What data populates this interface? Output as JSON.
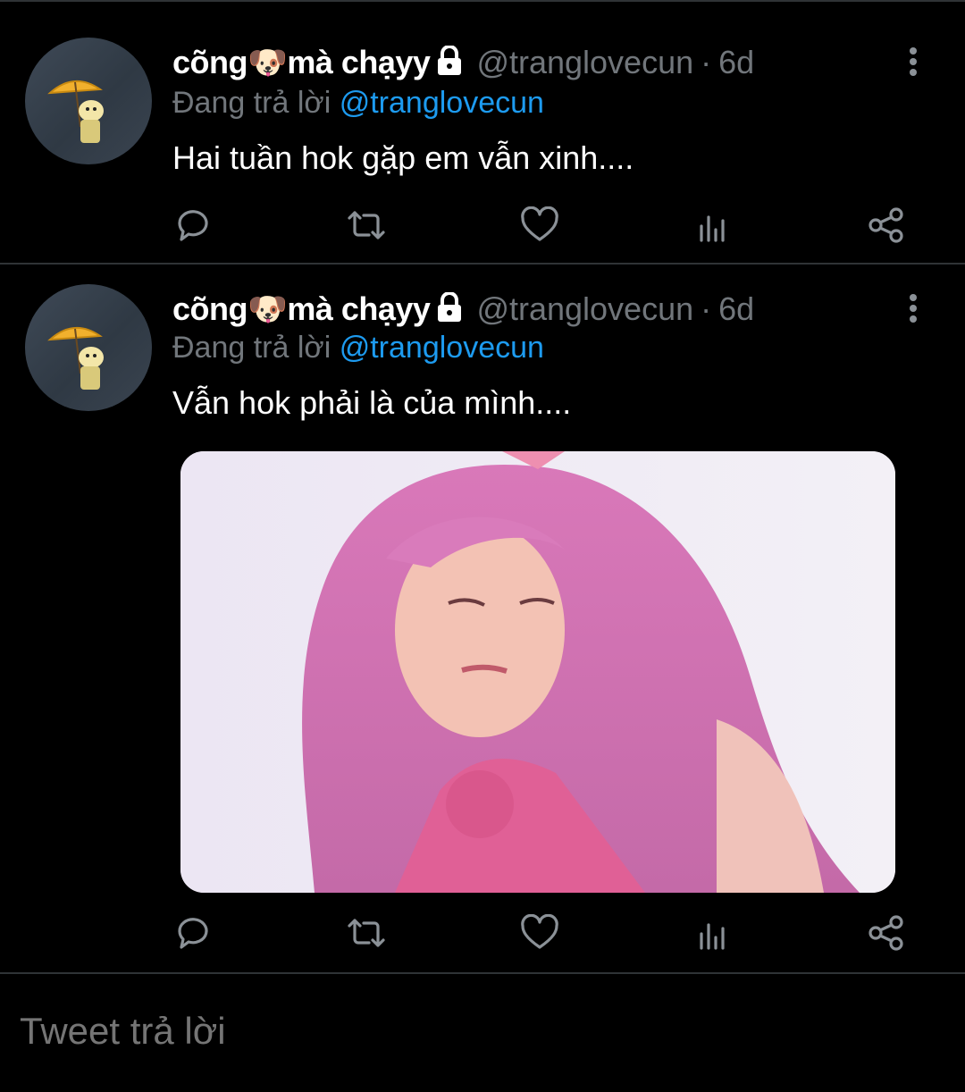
{
  "tweets": [
    {
      "display_name": "cõng🐶mà chạyy",
      "handle": "@tranglovecun",
      "separator": "·",
      "time": "6d",
      "reply_prefix": "Đang trả lời",
      "reply_to": "@tranglovecun",
      "text": "Hai tuần hok gặp em vẫn xinh....",
      "has_media": false
    },
    {
      "display_name": "cõng🐶mà chạyy",
      "handle": "@tranglovecun",
      "separator": "·",
      "time": "6d",
      "reply_prefix": "Đang trả lời",
      "reply_to": "@tranglovecun",
      "text": "Vẫn hok phải là của mình....",
      "has_media": true
    }
  ],
  "actions": [
    "reply-icon",
    "retweet-icon",
    "like-icon",
    "analytics-icon",
    "share-icon"
  ],
  "reply_box": {
    "placeholder": "Tweet trả lời"
  },
  "colors": {
    "background": "#000000",
    "text": "#e7e9ea",
    "muted": "#71767b",
    "link": "#1d9bf0",
    "divider": "#2f3336"
  }
}
